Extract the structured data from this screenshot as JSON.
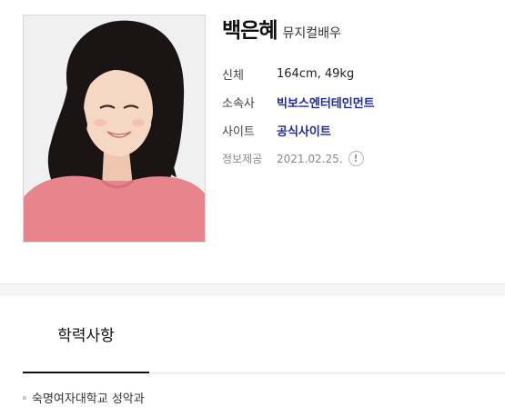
{
  "profile": {
    "name": "백은혜",
    "occupation": "뮤지컬배우",
    "photo": "profile-photo",
    "details": [
      {
        "label": "신체",
        "value": "164cm, 49kg"
      },
      {
        "label": "소속사",
        "value": "빅보스엔터테인먼트"
      },
      {
        "label": "사이트",
        "value": "공식사이트"
      }
    ],
    "source": {
      "label": "정보제공",
      "date": "2021.02.25.",
      "icon": "exclamation-icon"
    }
  },
  "tabs": [
    {
      "label": "학력사항"
    }
  ],
  "education": [
    {
      "text": "숙명여자대학교 성악과"
    }
  ],
  "colors": {
    "link": "#1f2aa1",
    "divider": "#f5f6f7",
    "sweater": "#e8848c"
  }
}
